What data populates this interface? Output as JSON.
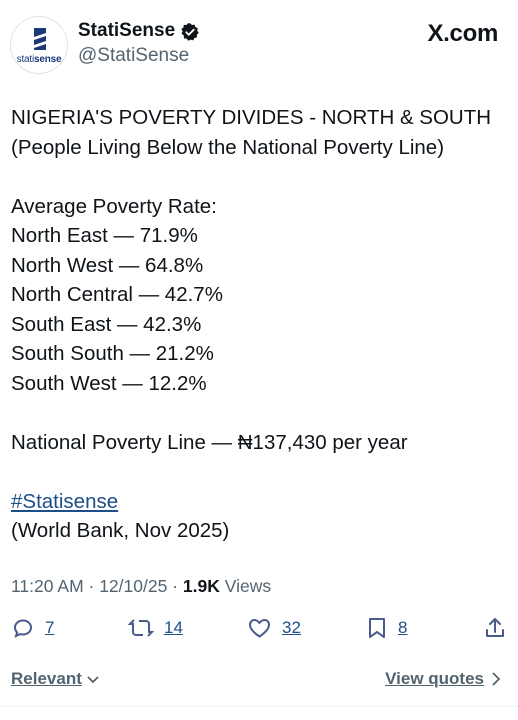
{
  "author": {
    "display_name": "StatiSense",
    "handle": "@StatiSense",
    "avatar_brand_prefix": "stati",
    "avatar_brand_suffix": "sense"
  },
  "site": "X.com",
  "post": {
    "title_line1": "NIGERIA'S POVERTY DIVIDES - NORTH & SOUTH",
    "title_line2": "(People Living Below the National Poverty Line)",
    "section_label": "Average Poverty Rate:",
    "regions": [
      "North East — 71.9%",
      "North West — 64.8%",
      "North Central — 42.7%",
      "South East — 42.3%",
      "South South — 21.2%",
      "South West — 12.2%"
    ],
    "poverty_line": "National Poverty Line — ₦137,430 per year",
    "hashtag": "#Statisense",
    "source": "(World Bank, Nov 2025)"
  },
  "meta": {
    "time": "11:20 AM",
    "date": "12/10/25",
    "views_count": "1.9K",
    "views_label": "Views"
  },
  "actions": {
    "replies": "7",
    "reposts": "14",
    "likes": "32",
    "bookmarks": "8"
  },
  "footer": {
    "sort_label": "Relevant",
    "view_quotes": "View quotes"
  },
  "colors": {
    "text": "#0f1419",
    "secondary": "#536471",
    "link": "#1d4e89",
    "verified": "#0f1419",
    "brand": "#1b3a7a"
  },
  "icons": [
    "verified-badge-icon",
    "reply-icon",
    "repost-icon",
    "like-icon",
    "bookmark-icon",
    "share-icon",
    "chevron-down-icon",
    "chevron-right-icon"
  ]
}
